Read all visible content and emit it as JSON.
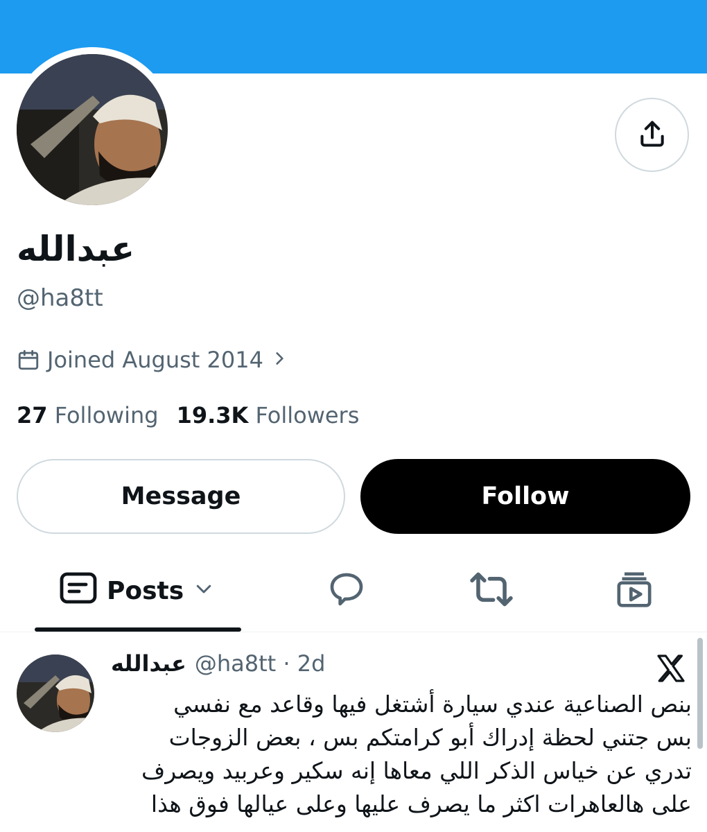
{
  "colors": {
    "banner": "#1d9bf0",
    "follow_bg": "#000000",
    "secondary_text": "#536471"
  },
  "profile": {
    "display_name": "عبدالله",
    "handle": "@ha8tt",
    "joined": "Joined August 2014",
    "following_count": "27",
    "following_label": "Following",
    "followers_count": "19.3K",
    "followers_label": "Followers"
  },
  "actions": {
    "share_icon": "share-icon",
    "message_label": "Message",
    "follow_label": "Follow"
  },
  "tabs": {
    "posts_label": "Posts",
    "icons": [
      "posts-icon",
      "chevron-down-icon",
      "replies-icon",
      "repost-icon",
      "media-icon"
    ]
  },
  "tweet": {
    "name": "عبدالله",
    "meta": "@ha8tt · 2d",
    "text": "بنص الصناعية عندي سيارة أشتغل فيها وقاعد مع نفسي\nبس جتني لحظة إدراك أبو كرامتكم بس ، بعض الزوجات\nتدري عن خياس الذكر اللي معاها إنه سكير وعربيد ويصرف\nعلى هالعاهرات اكثر ما يصرف عليها وعلى عيالها فوق هذا"
  }
}
